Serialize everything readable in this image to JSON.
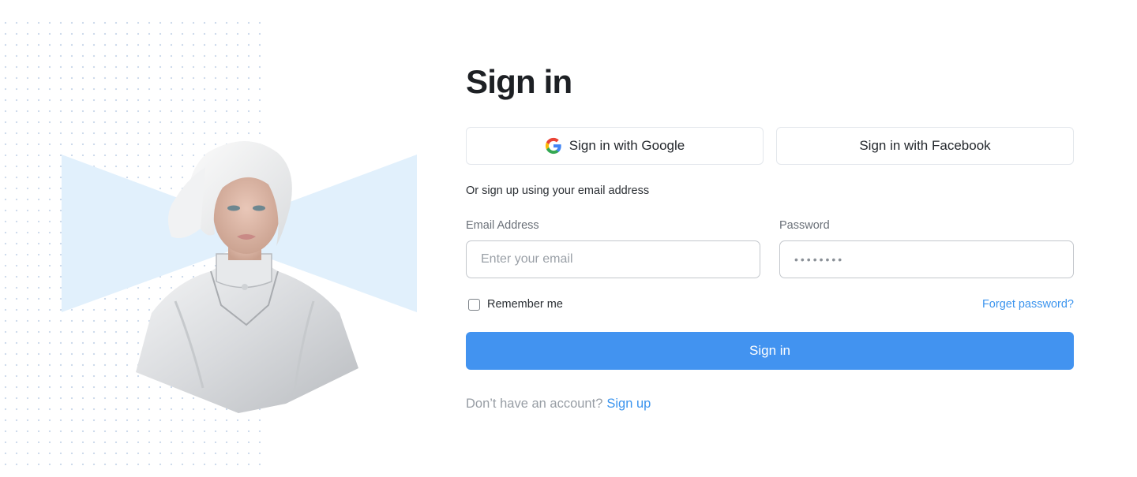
{
  "page": {
    "title": "Sign in",
    "social": {
      "google_label": "Sign in with Google",
      "facebook_label": "Sign in with Facebook",
      "google_icon": "google-icon"
    },
    "divider_text": "Or sign up using your email address",
    "email": {
      "label": "Email Address",
      "placeholder": "Enter your email",
      "value": ""
    },
    "password": {
      "label": "Password",
      "value": "••••••••"
    },
    "remember_label": "Remember me",
    "remember_checked": false,
    "forget_label": "Forget password?",
    "submit_label": "Sign in",
    "signup_question": "Don’t have an account?",
    "signup_link": "Sign up"
  },
  "colors": {
    "accent": "#4293f0",
    "link": "#3b94ee",
    "bowtie": "#e1f0fc"
  }
}
